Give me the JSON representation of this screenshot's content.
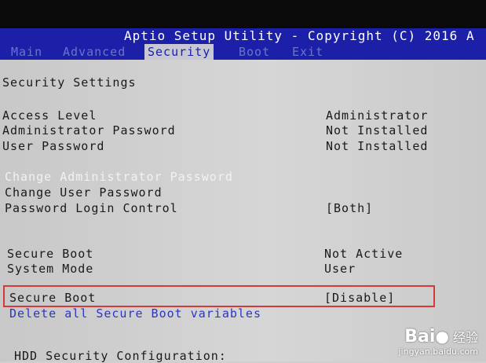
{
  "header": {
    "title": "Aptio Setup Utility - Copyright (C) 2016 A",
    "tabs": [
      "Main",
      "Advanced",
      "Security",
      "Boot",
      "Exit"
    ],
    "active_tab": "Security"
  },
  "section_title": "Security Settings",
  "info": [
    {
      "label": "Access Level",
      "value": "Administrator"
    },
    {
      "label": "Administrator Password",
      "value": "Not Installed"
    },
    {
      "label": "User Password",
      "value": "Not Installed"
    }
  ],
  "actions": {
    "change_admin": "Change Administrator Password",
    "change_user": "Change User Password",
    "password_login": {
      "label": "Password Login Control",
      "value": "[Both]"
    }
  },
  "secure_boot_status": [
    {
      "label": "Secure Boot",
      "value": "Not Active"
    },
    {
      "label": "System Mode",
      "value": "User"
    }
  ],
  "secure_boot_option": {
    "label": "Secure Boot",
    "value": "[Disable]"
  },
  "delete_keys": "Delete all Secure Boot variables",
  "hdd_security": "HDD Security Configuration:",
  "watermark": {
    "brand": "Bai",
    "cn": "经验",
    "url": "jingyan.baidu.com"
  },
  "colors": {
    "header_bg": "#1c20a8",
    "panel_bg": "#d0d0d0",
    "highlight_box": "#d33a3a"
  }
}
